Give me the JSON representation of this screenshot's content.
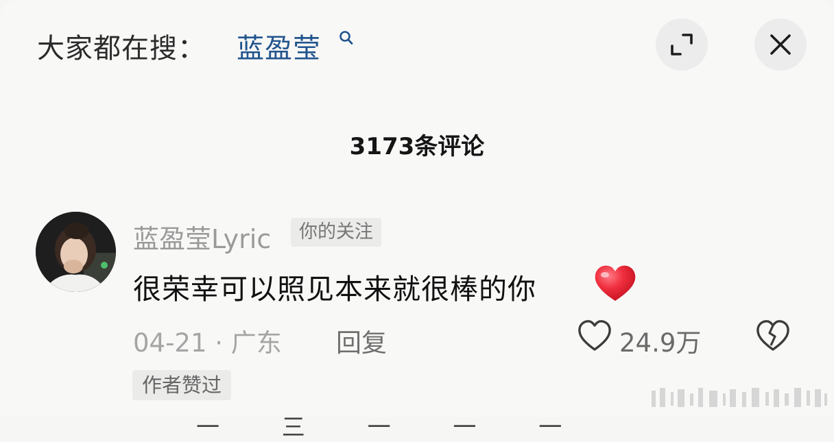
{
  "search_bar": {
    "prefix": "大家都在搜：",
    "term": "蓝盈莹",
    "term_icon": "search-icon"
  },
  "actions": {
    "expand_icon": "expand-icon",
    "close_icon": "close-icon"
  },
  "comments_header": {
    "count_label": "3173条评论"
  },
  "comment": {
    "username": "蓝盈莹Lyric",
    "follow_badge": "你的关注",
    "text": "很荣幸可以照见本来就很棒的你",
    "emoji": "red-heart",
    "date": "04-21 · 广东",
    "reply_label": "回复",
    "like_count": "24.9万",
    "author_liked_badge": "作者赞过"
  },
  "next_comment_peek": "一 三 一 一 一",
  "colors": {
    "accent_link": "#21548c",
    "heart": "#e8283a",
    "background": "#f8f8f7"
  }
}
